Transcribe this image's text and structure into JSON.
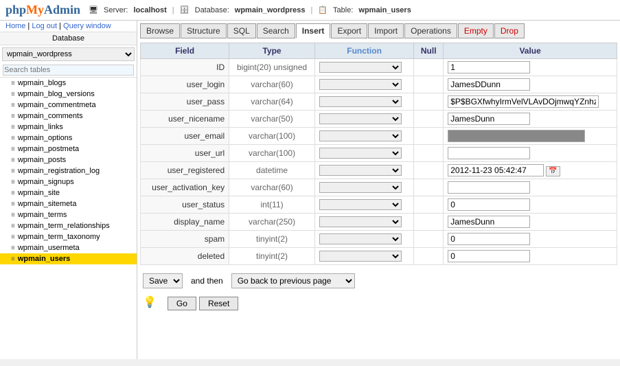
{
  "header": {
    "logo": "phpMyAdmin",
    "server_label": "Server:",
    "server_value": "localhost",
    "database_label": "Database:",
    "database_value": "...",
    "table_label": "Table:",
    "table_value": "wpmain_users"
  },
  "nav": {
    "home": "Home",
    "logout": "Log out",
    "query_window": "Query window"
  },
  "sidebar": {
    "db_label": "Database",
    "tables": [
      {
        "name": "wpmain_blogs",
        "active": false
      },
      {
        "name": "wpmain_blog_versions",
        "active": false
      },
      {
        "name": "wpmain_commentmeta",
        "active": false
      },
      {
        "name": "wpmain_comments",
        "active": false
      },
      {
        "name": "wpmain_links",
        "active": false
      },
      {
        "name": "wpmain_options",
        "active": false
      },
      {
        "name": "wpmain_postmeta",
        "active": false
      },
      {
        "name": "wpmain_posts",
        "active": false
      },
      {
        "name": "wpmain_registration_log",
        "active": false
      },
      {
        "name": "wpmain_signups",
        "active": false
      },
      {
        "name": "wpmain_site",
        "active": false
      },
      {
        "name": "wpmain_sitemeta",
        "active": false
      },
      {
        "name": "wpmain_terms",
        "active": false
      },
      {
        "name": "wpmain_term_relationships",
        "active": false
      },
      {
        "name": "wpmain_term_taxonomy",
        "active": false
      },
      {
        "name": "wpmain_usermeta",
        "active": false
      },
      {
        "name": "wpmain_users",
        "active": true
      }
    ]
  },
  "tabs": [
    {
      "label": "Browse",
      "active": false
    },
    {
      "label": "Structure",
      "active": false
    },
    {
      "label": "SQL",
      "active": false
    },
    {
      "label": "Search",
      "active": false
    },
    {
      "label": "Insert",
      "active": true
    },
    {
      "label": "Export",
      "active": false
    },
    {
      "label": "Import",
      "active": false
    },
    {
      "label": "Operations",
      "active": false
    },
    {
      "label": "Empty",
      "active": false,
      "danger": true
    },
    {
      "label": "Drop",
      "active": false,
      "danger": true
    }
  ],
  "table_headers": {
    "field": "Field",
    "type": "Type",
    "function": "Function",
    "null": "Null",
    "value": "Value"
  },
  "rows": [
    {
      "field": "ID",
      "type": "bigint(20) unsigned",
      "func": "",
      "null": false,
      "value": "1"
    },
    {
      "field": "user_login",
      "type": "varchar(60)",
      "func": "",
      "null": false,
      "value": "JamesDDunn"
    },
    {
      "field": "user_pass",
      "type": "varchar(64)",
      "func": "",
      "null": false,
      "value": "$P$BGXfwhyIrmVelVLAvDOjmwqYZnhzPj."
    },
    {
      "field": "user_nicename",
      "type": "varchar(50)",
      "func": "",
      "null": false,
      "value": "JamesDunn"
    },
    {
      "field": "user_email",
      "type": "varchar(100)",
      "func": "",
      "null": false,
      "value": ""
    },
    {
      "field": "user_url",
      "type": "varchar(100)",
      "func": "",
      "null": false,
      "value": ""
    },
    {
      "field": "user_registered",
      "type": "datetime",
      "func": "",
      "null": false,
      "value": "2012-11-23 05:42:47",
      "datetime": true
    },
    {
      "field": "user_activation_key",
      "type": "varchar(60)",
      "func": "",
      "null": false,
      "value": ""
    },
    {
      "field": "user_status",
      "type": "int(11)",
      "func": "",
      "null": false,
      "value": "0"
    },
    {
      "field": "display_name",
      "type": "varchar(250)",
      "func": "",
      "null": false,
      "value": "JamesDunn"
    },
    {
      "field": "spam",
      "type": "tinyint(2)",
      "func": "",
      "null": false,
      "value": "0"
    },
    {
      "field": "deleted",
      "type": "tinyint(2)",
      "func": "",
      "null": false,
      "value": "0"
    }
  ],
  "bottom": {
    "save_options": [
      "Save"
    ],
    "and_then_label": "and then",
    "goto_options": [
      "Go back to previous page"
    ],
    "go_button": "Go",
    "reset_button": "Reset"
  }
}
